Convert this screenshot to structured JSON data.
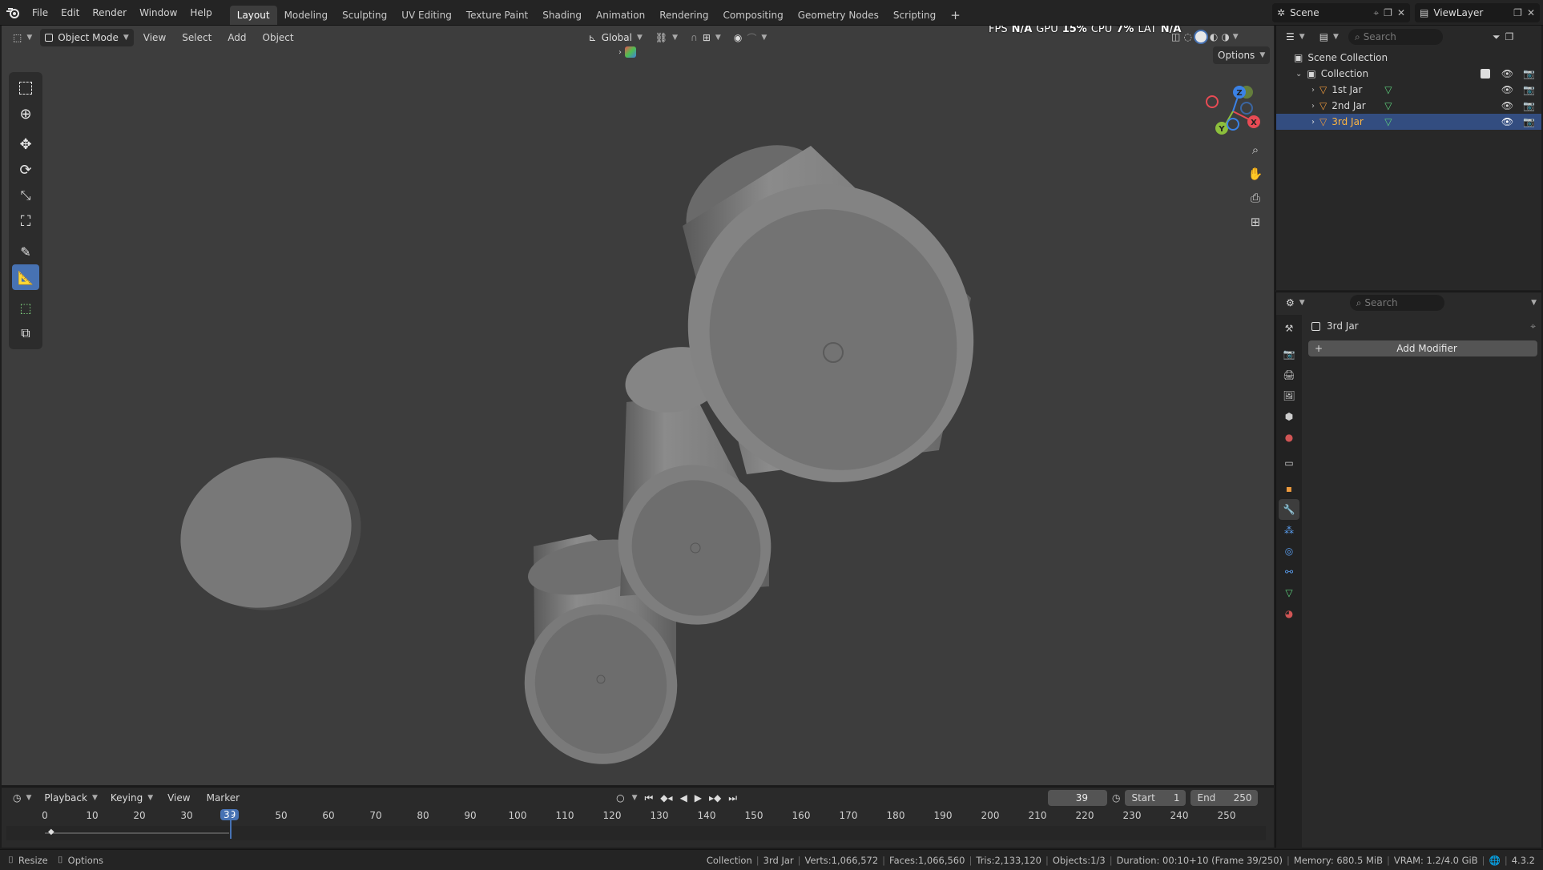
{
  "menu": {
    "items": [
      "File",
      "Edit",
      "Render",
      "Window",
      "Help"
    ]
  },
  "workspaces": {
    "tabs": [
      "Layout",
      "Modeling",
      "Sculpting",
      "UV Editing",
      "Texture Paint",
      "Shading",
      "Animation",
      "Rendering",
      "Compositing",
      "Geometry Nodes",
      "Scripting"
    ],
    "active": "Layout",
    "add_label": "+"
  },
  "scene": {
    "name": "Scene",
    "view_layer": "ViewLayer"
  },
  "viewport": {
    "mode": "Object Mode",
    "menus": [
      "View",
      "Select",
      "Add",
      "Object"
    ],
    "orientation": "Global",
    "options_label": "Options",
    "hud": {
      "fps_label": "FPS",
      "fps_value": "N/A",
      "gpu_label": "GPU",
      "gpu_value": "15%",
      "cpu_label": "CPU",
      "cpu_value": "7%",
      "lat_label": "LAT",
      "lat_value": "N/A"
    },
    "gizmo": {
      "x": "X",
      "y": "Y",
      "z": "Z"
    }
  },
  "toolbar": {
    "tools": [
      "select-box",
      "cursor",
      "move",
      "rotate",
      "scale",
      "transform",
      "annotate",
      "measure",
      "add-cube",
      "extrude"
    ],
    "active": "measure"
  },
  "outliner": {
    "search_placeholder": "Search",
    "root": "Scene Collection",
    "collection": "Collection",
    "objects": [
      {
        "name": "1st Jar",
        "selected": false
      },
      {
        "name": "2nd Jar",
        "selected": false
      },
      {
        "name": "3rd Jar",
        "selected": true
      }
    ]
  },
  "properties": {
    "search_placeholder": "Search",
    "object_name": "3rd Jar",
    "add_modifier_label": "Add Modifier",
    "active_tab": "modifiers"
  },
  "timeline": {
    "menus": [
      "Playback",
      "Keying",
      "View",
      "Marker"
    ],
    "current_frame": "39",
    "start_label": "Start",
    "start_value": "1",
    "end_label": "End",
    "end_value": "250",
    "ticks": [
      "0",
      "10",
      "20",
      "30",
      "50",
      "60",
      "70",
      "80",
      "90",
      "100",
      "110",
      "120",
      "130",
      "140",
      "150",
      "160",
      "170",
      "180",
      "190",
      "200",
      "210",
      "220",
      "230",
      "240",
      "250"
    ],
    "playhead_label": "39"
  },
  "statusbar": {
    "left": [
      "Resize",
      "Options"
    ],
    "collection": "Collection",
    "object": "3rd Jar",
    "verts": "Verts:1,066,572",
    "faces": "Faces:1,066,560",
    "tris": "Tris:2,133,120",
    "objects": "Objects:1/3",
    "duration": "Duration: 00:10+10 (Frame 39/250)",
    "memory": "Memory: 680.5 MiB",
    "vram": "VRAM: 1.2/4.0 GiB",
    "version": "4.3.2"
  },
  "colors": {
    "accent": "#4772b3",
    "selected_row": "#334d80",
    "selected_text": "#ffb640",
    "viewport_bg": "#3d3d3d",
    "axis_x": "#e84b54",
    "axis_y": "#8cbf3c",
    "axis_z": "#3b82e6"
  }
}
